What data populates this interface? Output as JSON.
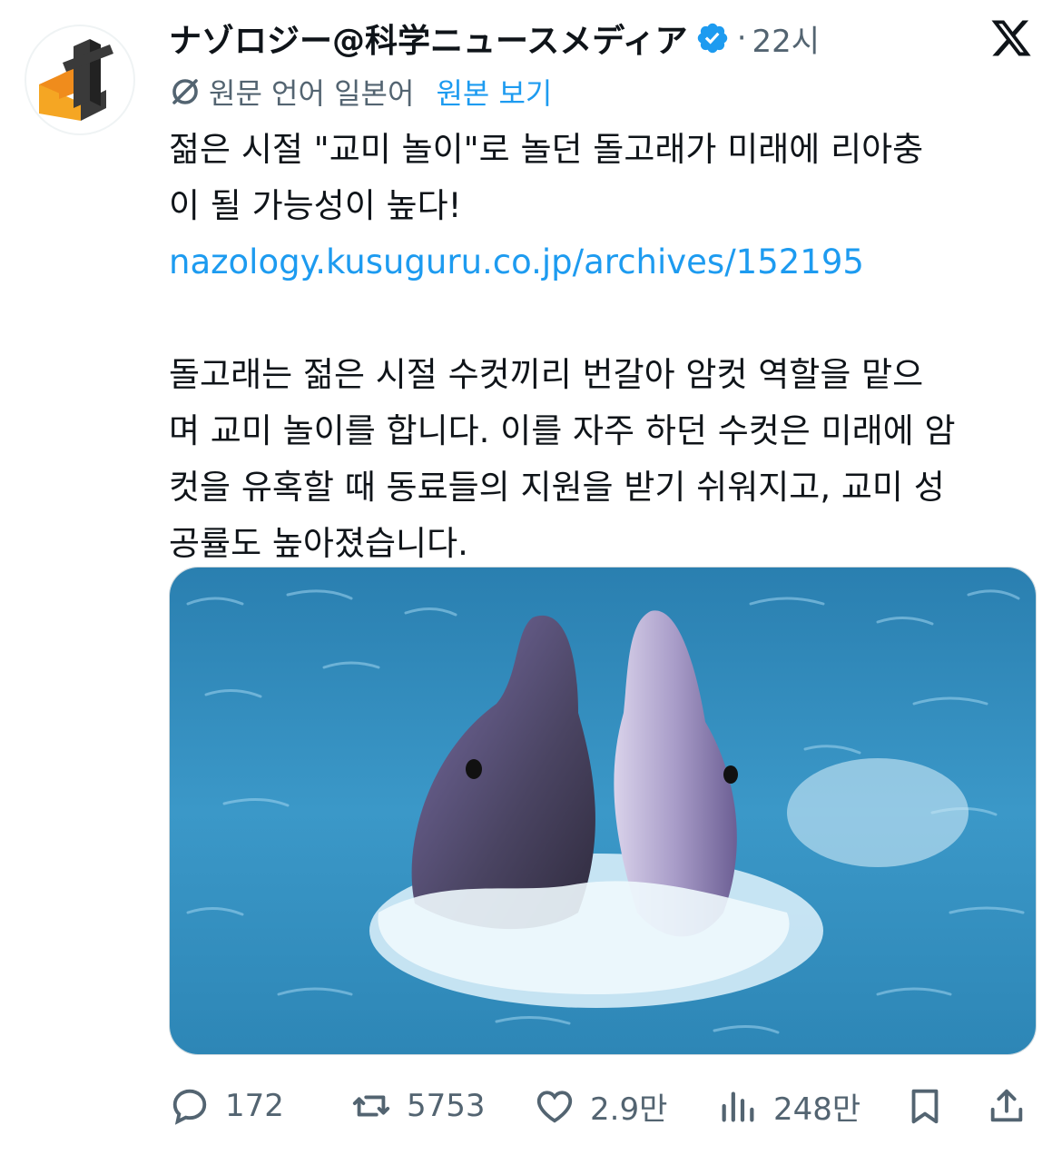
{
  "author": {
    "display_name": "ナゾロジー@科学ニュースメディア",
    "time": "22시",
    "separator": "·"
  },
  "translation": {
    "source_label": "원문 언어 일본어",
    "show_original": "원본 보기"
  },
  "tweet": {
    "line1": "젊은 시절 \"교미 놀이\"로 놀던 돌고래가 미래에 리아충",
    "line2": "이 될 가능성이 높다!",
    "link": "nazology.kusuguru.co.jp/archives/152195",
    "body1": "돌고래는 젊은 시절 수컷끼리 번갈아 암컷 역할을 맡으",
    "body2": "며 교미 놀이를 합니다. 이를 자주 하던 수컷은 미래에 암",
    "body3": "컷을 유혹할 때 동료들의 지원을 받기 쉬워지고, 교미 성",
    "body4": "공률도 높아졌습니다."
  },
  "actions": {
    "reply_count": "172",
    "retweet_count": "5753",
    "like_count": "2.9만",
    "view_count": "248만"
  },
  "icons": [
    "verified-badge-icon",
    "x-logo-icon",
    "translate-icon",
    "reply-icon",
    "retweet-icon",
    "like-icon",
    "views-icon",
    "bookmark-icon",
    "share-icon"
  ],
  "colors": {
    "accent": "#1d9bf0",
    "muted": "#536471",
    "logo_orange": "#f5a623",
    "text": "#0f1419"
  }
}
